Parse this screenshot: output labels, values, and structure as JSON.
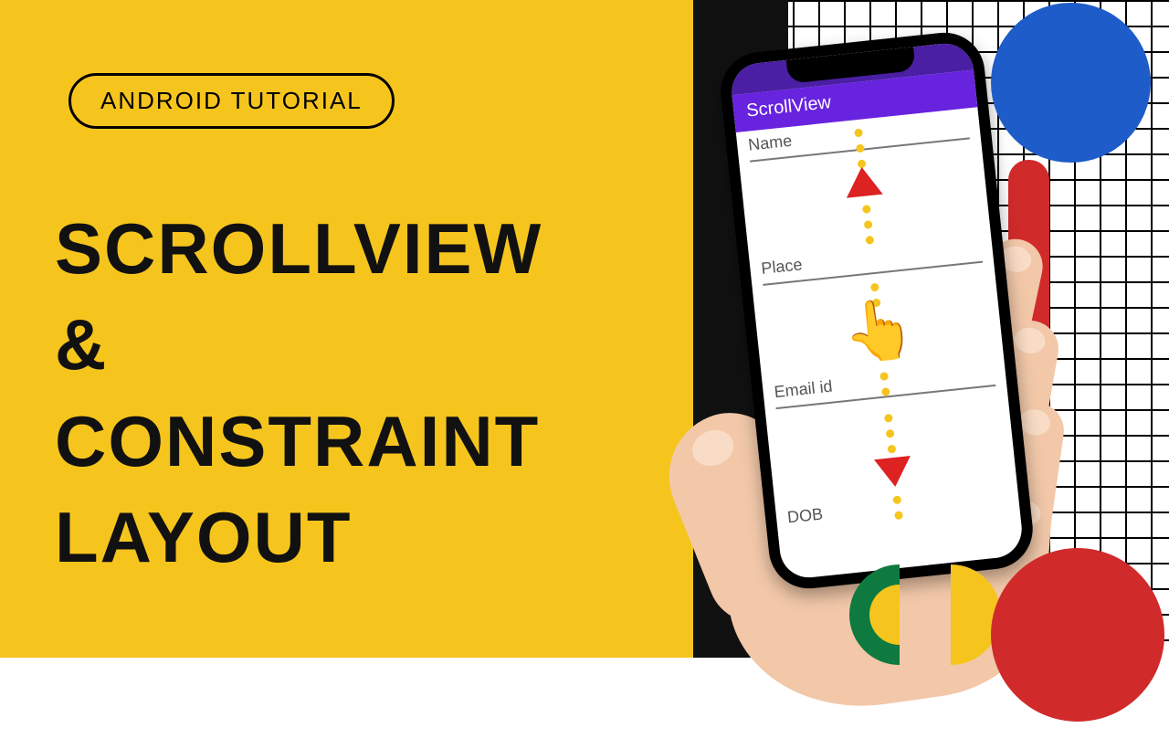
{
  "badge": {
    "label": "ANDROID TUTORIAL"
  },
  "title": {
    "line1": "SCROLLVIEW",
    "line2": "&",
    "line3": "CONSTRAINT LAYOUT"
  },
  "phone": {
    "appbar_title": "ScrollView",
    "fields": {
      "name": "Name",
      "place": "Place",
      "email": "Email id",
      "dob": "DOB"
    }
  },
  "icons": {
    "pointing_hand": "👆"
  },
  "colors": {
    "yellow": "#F6C51D",
    "blue": "#1E5CC9",
    "red": "#D12A2A",
    "green": "#0E7A40",
    "purple": "#6823DF"
  }
}
